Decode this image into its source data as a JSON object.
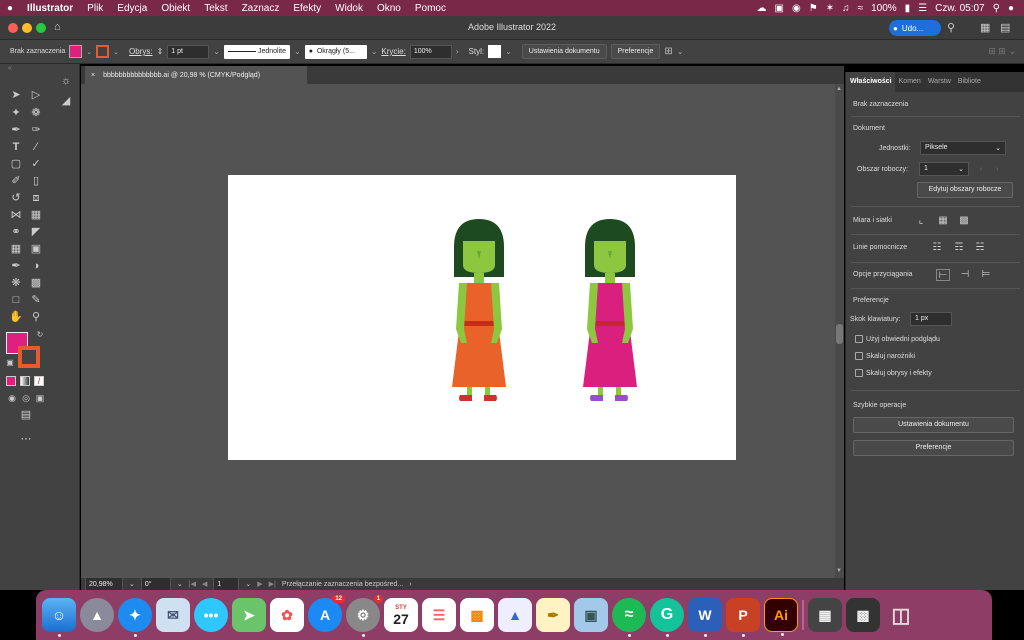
{
  "menubar": {
    "apple": "",
    "app_name": "Illustrator",
    "items": [
      "Plik",
      "Edycja",
      "Obiekt",
      "Tekst",
      "Zaznacz",
      "Efekty",
      "Widok",
      "Okno",
      "Pomoc"
    ],
    "battery": "100%",
    "clock": "Czw. 05:07"
  },
  "window": {
    "title": "Adobe Illustrator 2022",
    "user_button": "Udo..."
  },
  "control_bar": {
    "selection": "Brak zaznaczenia",
    "stroke_label": "Obrys:",
    "stroke_value": "1 pt",
    "stroke_style": "Jednolite",
    "brush": "Okrągły (5...",
    "opacity_label": "Krycie:",
    "opacity_value": "100%",
    "style_label": "Styl:",
    "doc_setup": "Ustawienia dokumentu",
    "preferences": "Preferencje",
    "fill_color": "#e0207e",
    "stroke_color": "#e85a2c"
  },
  "document": {
    "tab_close": "×",
    "tab_title": "bbbbbbbbbbbbbbb.ai @ 20,98 % (CMYK/Podgląd)"
  },
  "statusbar": {
    "zoom": "20,98%",
    "rotation": "0°",
    "artboard": "1",
    "status": "Przełączanie zaznaczenia bezpośred..."
  },
  "panel": {
    "tabs": [
      "Właściwości",
      "Komen",
      "Warstw",
      "Bibliote"
    ],
    "no_selection": "Brak zaznaczenia",
    "document_header": "Dokument",
    "units_label": "Jednostki:",
    "units_value": "Piksele",
    "artboard_label": "Obszar roboczy:",
    "artboard_value": "1",
    "edit_artboards": "Edytuj obszary robocze",
    "rulers_grids": "Miara i siatki",
    "guides": "Linie pomocnicze",
    "snap_options": "Opcje przyciągania",
    "preferences_header": "Preferencje",
    "keyboard_increment_label": "Skok klawiatury:",
    "keyboard_increment_value": "1 px",
    "use_preview_bounds": "Użyj obwiedni podglądu",
    "scale_corners": "Skaluj narożniki",
    "scale_strokes": "Skaluj obrysy i efekty",
    "quick_actions": "Szybkie operacje",
    "doc_setup_button": "Ustawienia dokumentu",
    "preferences_button": "Preferencje"
  },
  "artwork": {
    "hair_color": "#1e4a20",
    "skin_color": "#8dc63f",
    "figure1_dress": "#e8622a",
    "figure2_dress": "#d9207e",
    "belt_color": "#c62828",
    "figure1_shoes": "#d32f2f",
    "figure2_shoes": "#9c4dcc"
  },
  "dock": {
    "calendar_month": "STY",
    "calendar_day": "27",
    "appstore_badge": "12",
    "settings_badge": "1",
    "ai_label": "Ai",
    "word_label": "W",
    "ppt_label": "P"
  }
}
